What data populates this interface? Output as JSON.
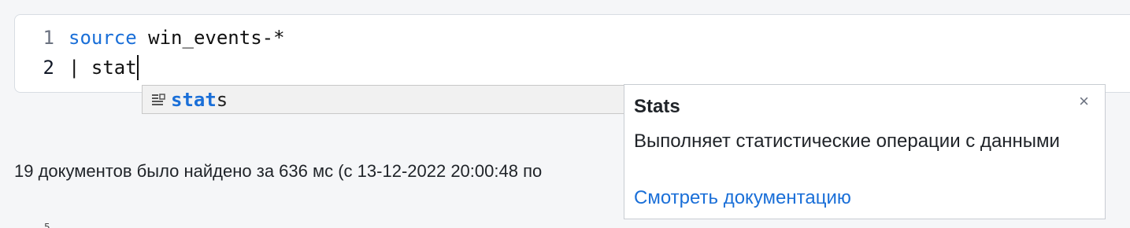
{
  "editor": {
    "lines": [
      {
        "number": "1",
        "keyword": "source",
        "text": " win_events-*"
      },
      {
        "number": "2",
        "keyword": "",
        "text": "| stat"
      }
    ]
  },
  "autocomplete": {
    "icon": "snippet-list-icon",
    "match": "stat",
    "rest": "s"
  },
  "doc_popup": {
    "title": "Stats",
    "close": "×",
    "description": "Выполняет статистические операции с данными",
    "link": "Смотреть документацию"
  },
  "status": {
    "text": "19 документов было найдено за 636 мс (с 13-12-2022 20:00:48 по"
  },
  "axis_fragment": "5",
  "colors": {
    "keyword": "#1a6fd8",
    "link": "#1a6fd8",
    "background": "#f5f6f8"
  }
}
